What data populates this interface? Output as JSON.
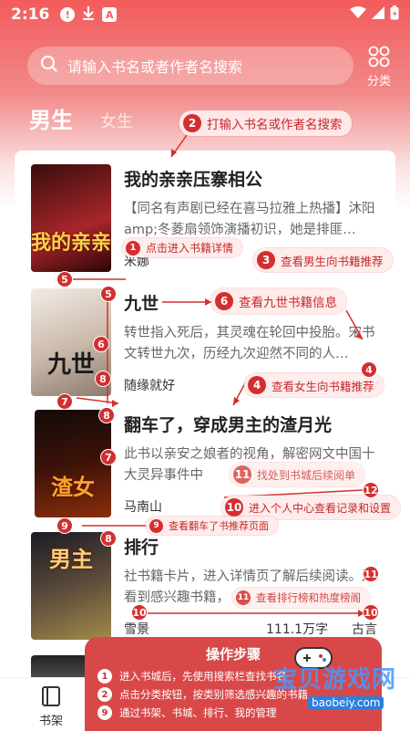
{
  "status_bar": {
    "time": "2:16",
    "left_icons": [
      "alert-icon",
      "download-icon",
      "font-icon"
    ],
    "right_icons": [
      "wifi-icon",
      "signal-icon",
      "battery-icon"
    ]
  },
  "search": {
    "placeholder": "请输入书名或者作者名搜索"
  },
  "category": {
    "label": "分类"
  },
  "tabs": {
    "male": "男生",
    "female": "女生"
  },
  "books": [
    {
      "title": "我的亲亲压寨相公",
      "desc": "【同名有声剧已经在喜马拉雅上热播】沐阳amp;冬菱扇领饰演播初识，她是排匪…",
      "author": "米娜",
      "words": "",
      "genre": "",
      "cover_text": "我的亲亲",
      "cover_colors": [
        "#3a0d0d",
        "#a8262a"
      ]
    },
    {
      "title": "九世",
      "desc": "转世指入死后，其灵魂在轮回中投胎。宋书文转世九次，历经九次迎然不同的人…",
      "author": "随缘就好",
      "words": "",
      "genre": "",
      "cover_text": "九世",
      "cover_colors": [
        "#e9e2dc",
        "#b9a89a"
      ]
    },
    {
      "title": "翻车了，穿成男主的渣月光",
      "desc": "此书以亲安之娘者的视角，解密网文中国十大灵异事件中",
      "author": "马南山",
      "words": "",
      "genre": "",
      "cover_text": "渣女",
      "cover_colors": [
        "#120a08",
        "#8a2e0c"
      ]
    },
    {
      "title": "排行",
      "desc": "社书籍卡片，进入详情页了解后续阅读。还看到感兴趣书籍，",
      "author": "雪景",
      "words": "111.1万字",
      "genre": "古言",
      "cover_text": "男主",
      "cover_colors": [
        "#1b1b24",
        "#a38a4a"
      ]
    }
  ],
  "annotations": [
    {
      "n": "2",
      "text": "打输入书名或作者名搜索"
    },
    {
      "n": "1",
      "text": "点击进入书籍详情"
    },
    {
      "n": "3",
      "text": "查看男生向书籍推荐"
    },
    {
      "n": "6",
      "text": "查看九世书籍信息"
    },
    {
      "n": "4",
      "text": "查看女生向书籍推荐"
    },
    {
      "n": "11",
      "text": "找处到书城后续阅单"
    },
    {
      "n": "10",
      "text": "进入个人中心查看记录和设置"
    },
    {
      "n": "9",
      "text": "查看翻车了书推荐页面"
    },
    {
      "n": "11",
      "text": "查看排行榜和热度榜阁"
    }
  ],
  "markers": [
    "5",
    "5",
    "6",
    "8",
    "7",
    "8",
    "7",
    "4",
    "9",
    "8",
    "12",
    "10",
    "10",
    "11"
  ],
  "steps_panel": {
    "title": "操作步骤",
    "rows": [
      {
        "n": "1",
        "text": "进入书城后，先使用搜索栏查找书名"
      },
      {
        "n": "2",
        "text": "点击分类按钮，按类别筛选感兴趣的书籍"
      },
      {
        "n": "9",
        "text": "通过书架、书城、排行、我的管理"
      }
    ]
  },
  "watermark": {
    "cn": "宝贝游戏网",
    "url": "baobeiy.com"
  },
  "bottom_nav": {
    "shelf": "书架"
  }
}
